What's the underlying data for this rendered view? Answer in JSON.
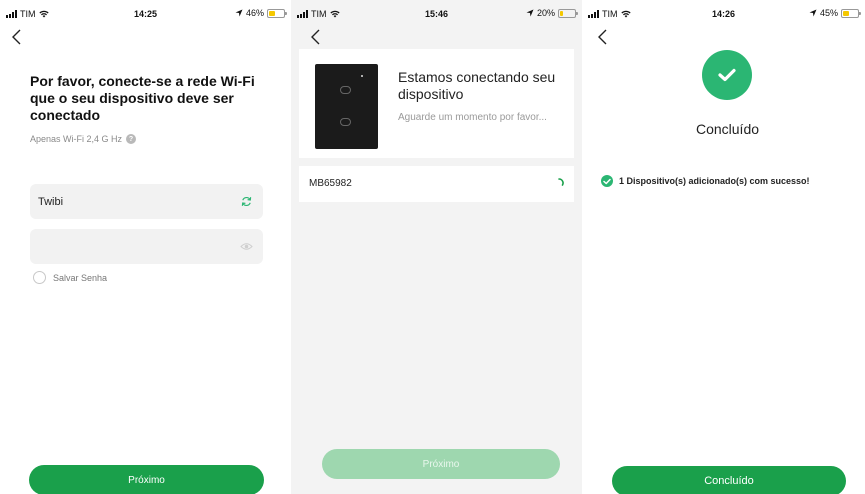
{
  "screens": [
    {
      "status": {
        "carrier": "TIM",
        "time": "14:25",
        "battery": "46%",
        "battery_level": 0.46
      },
      "title": "Por favor, conecte-se a rede Wi-Fi que o seu dispositivo deve ser conectado",
      "subtitle": "Apenas Wi-Fi 2,4 G Hz",
      "ssid_value": "Twibi",
      "password_value": "",
      "save_password_label": "Salvar Senha",
      "next_button": "Próximo"
    },
    {
      "status": {
        "carrier": "TIM",
        "time": "15:46",
        "battery": "20%",
        "battery_level": 0.2,
        "charging": true
      },
      "heading": "Estamos conectando seu dispositivo",
      "wait_text": "Aguarde um momento por favor...",
      "device_name": "MB65982",
      "next_button": "Próximo"
    },
    {
      "status": {
        "carrier": "TIM",
        "time": "14:26",
        "battery": "45%",
        "battery_level": 0.45
      },
      "title": "Concluído",
      "success_message": "1 Dispositivo(s) adicionado(s) com sucesso!",
      "done_button": "Concluído"
    }
  ],
  "colors": {
    "accent": "#1aa04b",
    "accent_disabled": "#9ed7af",
    "success": "#2bb673"
  },
  "icons": [
    "back-chevron-icon",
    "signal-icon",
    "wifi-icon",
    "location-icon",
    "battery-icon",
    "refresh-icon",
    "eye-icon",
    "question-icon",
    "check-icon",
    "spinner-icon"
  ]
}
